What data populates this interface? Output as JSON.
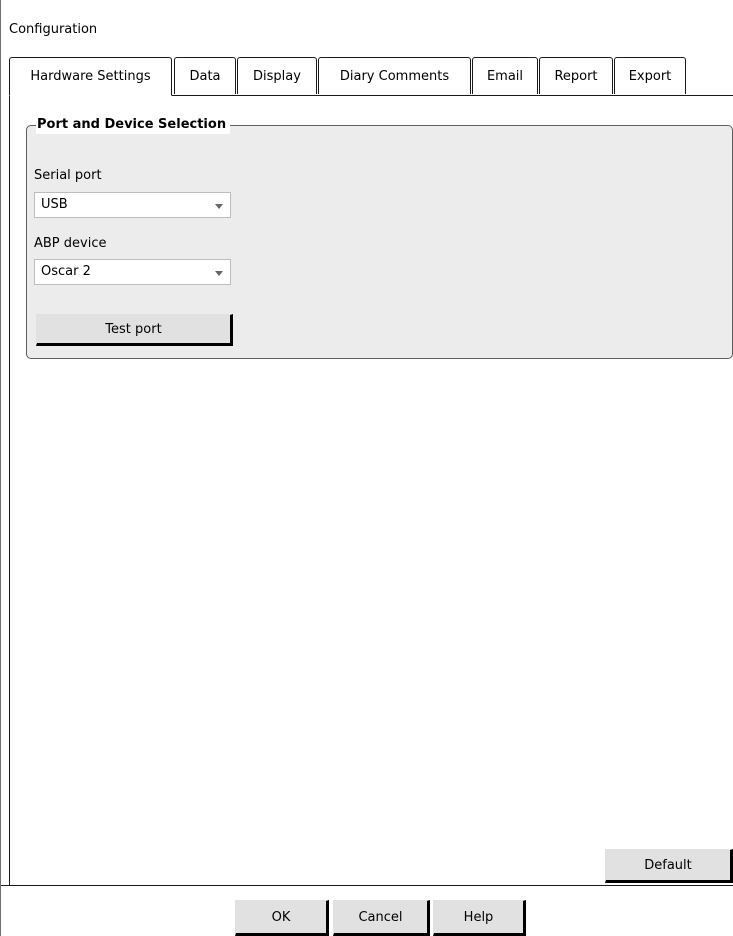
{
  "window": {
    "title": "Configuration"
  },
  "tabs": [
    {
      "label": "Hardware Settings",
      "active": true
    },
    {
      "label": "Data",
      "active": false
    },
    {
      "label": "Display",
      "active": false
    },
    {
      "label": "Diary Comments",
      "active": false
    },
    {
      "label": "Email",
      "active": false
    },
    {
      "label": "Report",
      "active": false
    },
    {
      "label": "Export",
      "active": false
    }
  ],
  "port_section": {
    "title": "Port and Device Selection",
    "serial_port": {
      "label": "Serial port",
      "value": "USB"
    },
    "abp_device": {
      "label": "ABP device",
      "value": "Oscar 2"
    },
    "test_button": "Test port"
  },
  "default_button": "Default",
  "footer": {
    "ok": "OK",
    "cancel": "Cancel",
    "help": "Help"
  },
  "colors": {
    "group_background": "#ececec",
    "button_face": "#e1e1e1"
  }
}
